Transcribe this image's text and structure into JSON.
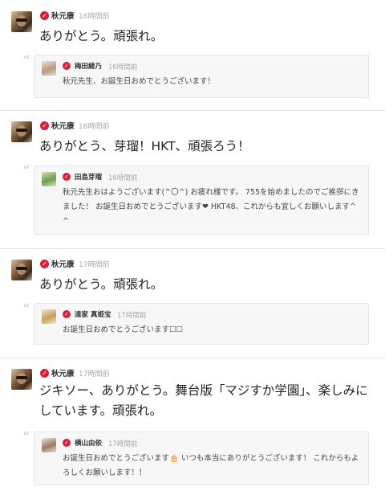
{
  "posts": [
    {
      "author": "秋元康",
      "time": "16時間前",
      "message": "ありがとう。頑張れ。",
      "reply": {
        "author": "梅田綾乃",
        "time": "16時間前",
        "text": "秋元先生、お誕生日おめでとうございます！"
      }
    },
    {
      "author": "秋元康",
      "time": "16時間前",
      "message": "ありがとう、芽瑠！HKT、頑張ろう！",
      "reply": {
        "author": "田島芽瑠",
        "time": "16時間前",
        "text": "秋元先生おはようございます(^〇^) お疲れ様です。 755を始めましたのでご挨拶にきました！ お誕生日おめでとうございます❤ HKT48、これからも宜しくお願いします^ ^"
      }
    },
    {
      "author": "秋元康",
      "time": "17時間前",
      "message": "ありがとう。頑張れ。",
      "reply": {
        "author": "達家 真姫宝",
        "time": "17時間前",
        "text": "お誕生日おめでとうございます☐☐"
      }
    },
    {
      "author": "秋元康",
      "time": "17時間前",
      "message": "ジキソー、ありがとう。舞台版「マジすか学園」、楽しみにしています。頑張れ。",
      "reply": {
        "author": "横山由依",
        "time": "17時間前",
        "text": "お誕生日おめでとうございます🎂 いつも本当にありがとうございます！ これからもよろしくお願いします！！"
      }
    }
  ],
  "icons": {
    "verified": "verified-check-icon",
    "quote": "quote-mark-icon"
  },
  "colors": {
    "verified": "#d6203b",
    "quote_bg": "#f7f7f7",
    "divider": "#e4e4e4"
  }
}
